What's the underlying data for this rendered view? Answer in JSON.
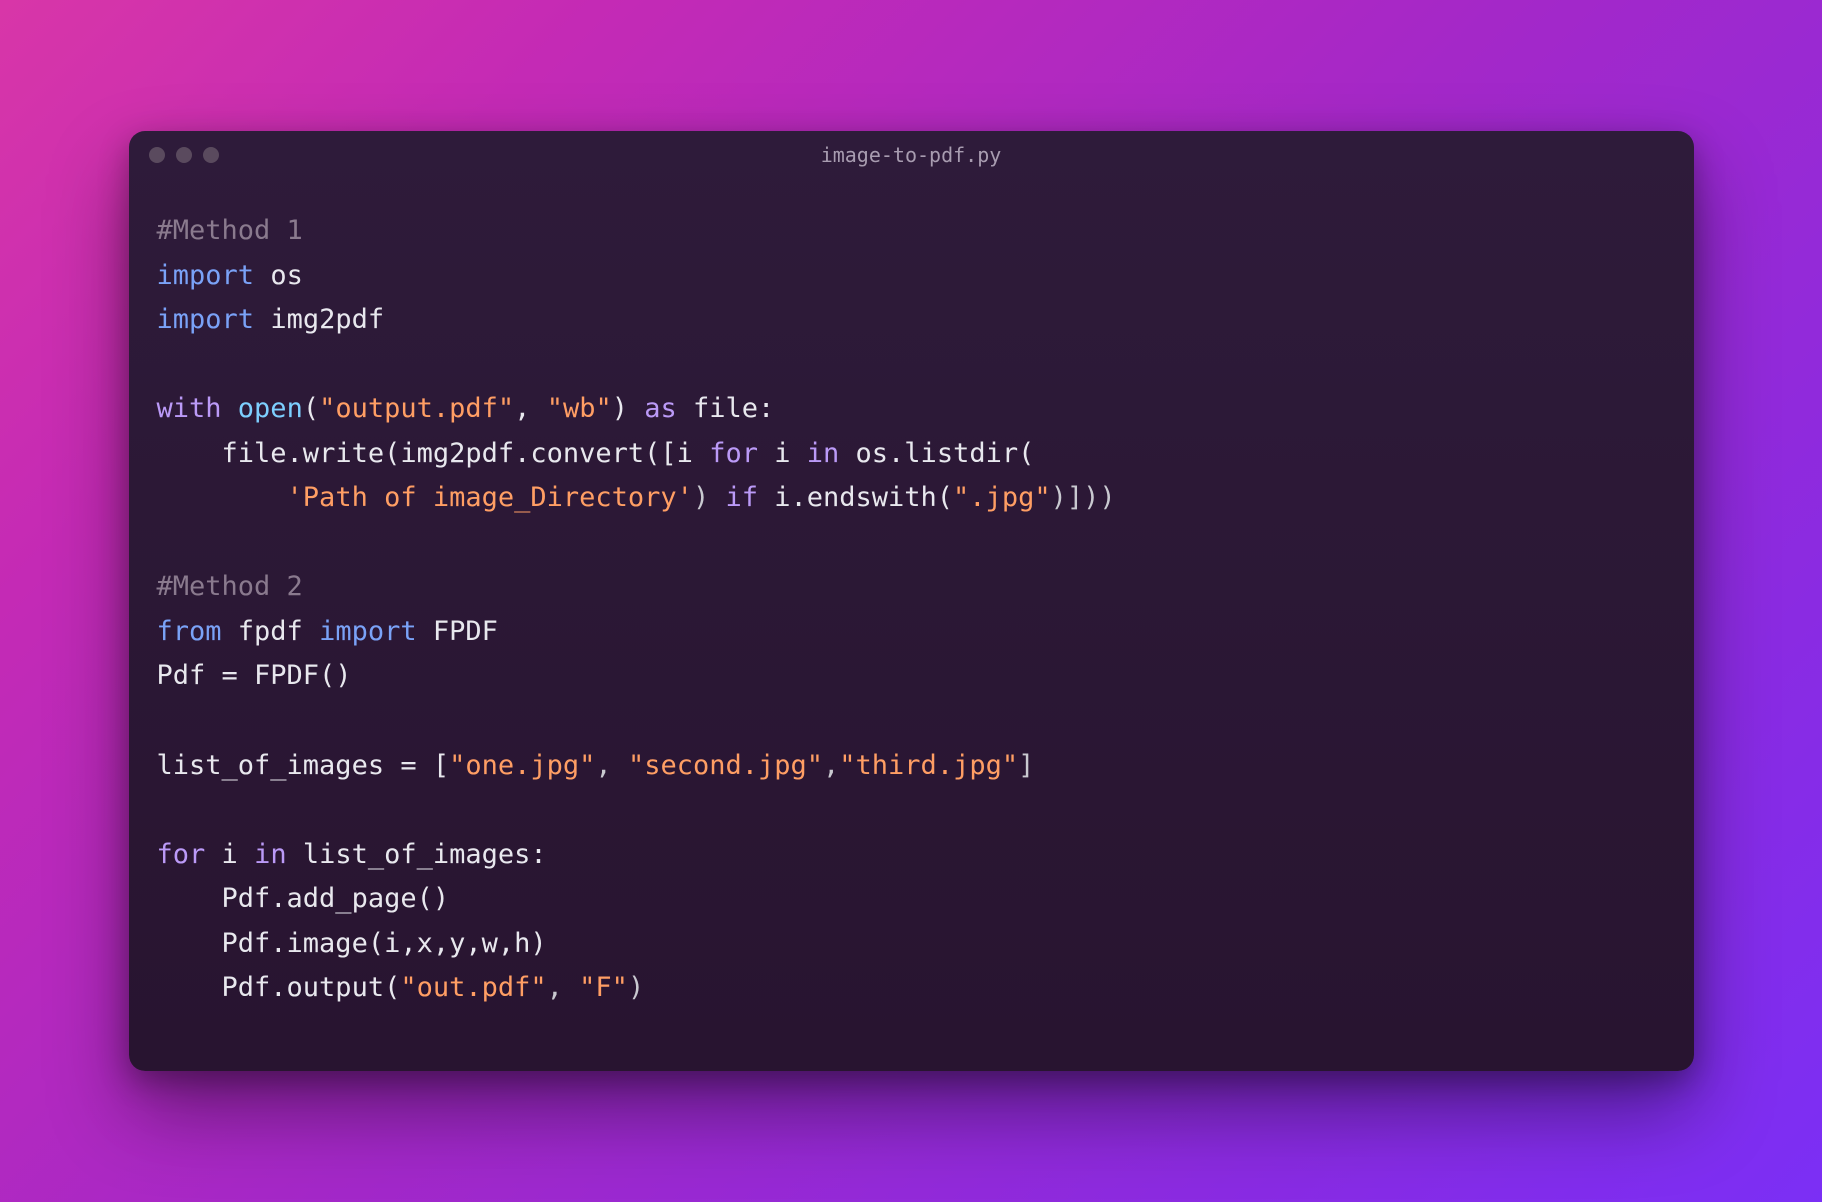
{
  "window": {
    "title": "image-to-pdf.py"
  },
  "code": {
    "line1_comment": "#Method 1",
    "line2_import": "import",
    "line2_module": "os",
    "line3_import": "import",
    "line3_module": "img2pdf",
    "line5_with": "with",
    "line5_open": "open",
    "line5_str1": "\"output.pdf\"",
    "line5_str2": "\"wb\"",
    "line5_as": "as",
    "line5_file": "file:",
    "line6_fw": "file.write(img2pdf.convert([i ",
    "line6_for": "for",
    "line6_i": " i ",
    "line6_in": "in",
    "line6_rest": " os.listdir(",
    "line7_str": "'Path of image_Directory'",
    "line7_paren": ") ",
    "line7_if": "if",
    "line7_ends": " i.endswith(",
    "line7_str2": "\".jpg\"",
    "line7_close": ")]))",
    "line9_comment": "#Method 2",
    "line10_from": "from",
    "line10_fpdf": " fpdf ",
    "line10_import": "import",
    "line10_FPDF": " FPDF",
    "line11_assign": "Pdf = FPDF()",
    "line13_list": "list_of_images = [",
    "line13_s1": "\"one.jpg\"",
    "line13_c1": ", ",
    "line13_s2": "\"second.jpg\"",
    "line13_c2": ",",
    "line13_s3": "\"third.jpg\"",
    "line13_close": "]",
    "line15_for": "for",
    "line15_i": " i ",
    "line15_in": "in",
    "line15_rest": " list_of_images:",
    "line16": "    Pdf.add_page()",
    "line17": "    Pdf.image(i,x,y,w,h)",
    "line18_a": "    Pdf.output(",
    "line18_s1": "\"out.pdf\"",
    "line18_c": ", ",
    "line18_s2": "\"F\"",
    "line18_close": ")"
  }
}
